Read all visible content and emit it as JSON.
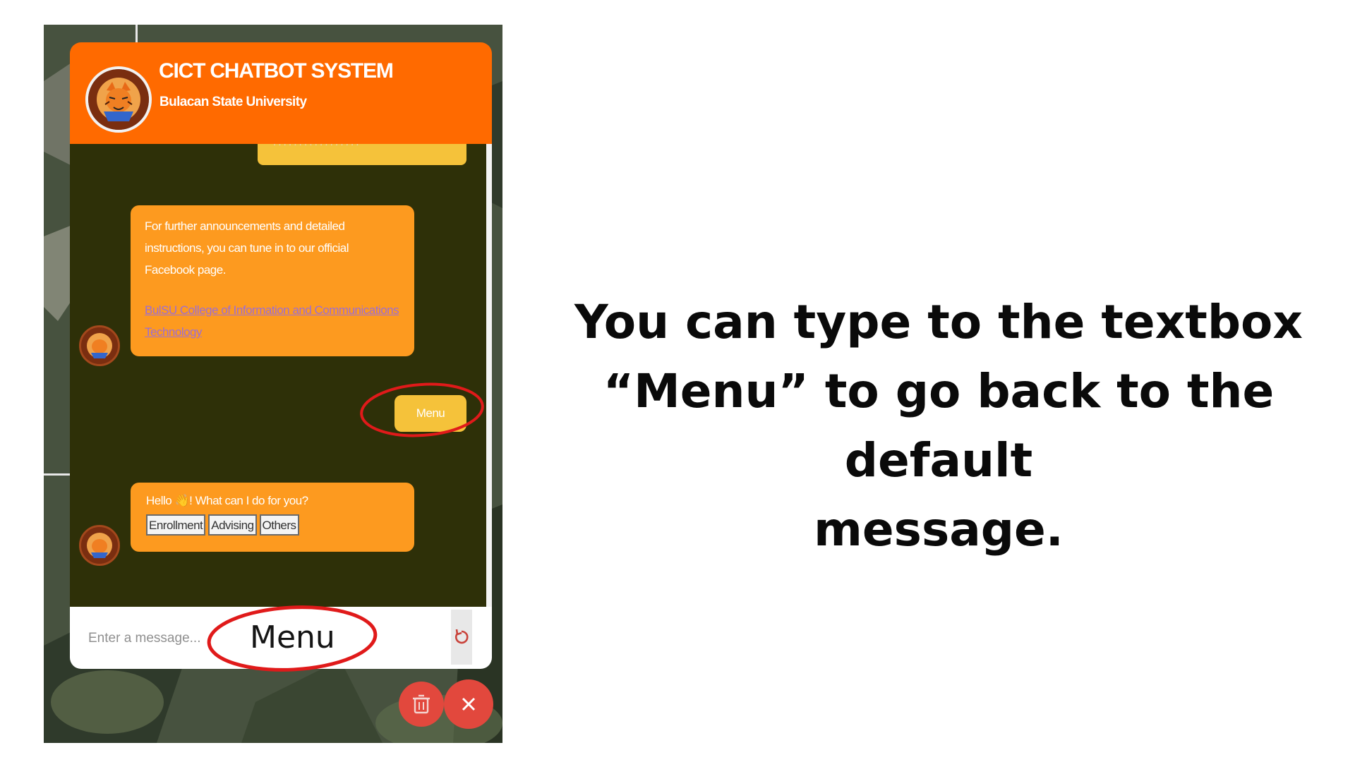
{
  "chatbot": {
    "header": {
      "title": "CICT CHATBOT SYSTEM",
      "subtitle": "Bulacan State University"
    },
    "messages": {
      "bot_announcement": "For further announcements and detailed instructions, you can tune in to our official Facebook page.",
      "bot_link": "BulSU College of Information and Communications Technology",
      "user_menu": "Menu",
      "bot_greeting": "Hello 👋! What can I do for you?",
      "quick_replies": [
        "Enrollment",
        "Advising",
        "Others"
      ]
    },
    "input": {
      "placeholder": "Enter a message...",
      "value": "Menu"
    }
  },
  "caption": {
    "line1": "You can type to the textbox",
    "line2": "“Menu” to go back to the default",
    "line3": "message."
  },
  "colors": {
    "header": "#ff6a00",
    "bot_bubble": "#fd9a1f",
    "user_bubble": "#f5c23a",
    "chat_background": "#2e3008",
    "annotation": "#e01a1a",
    "fab": "#e2483d"
  },
  "icons": {
    "refresh": "refresh-icon",
    "delete": "trash-icon",
    "close": "close-icon",
    "logo": "tiger-mascot-logo"
  }
}
